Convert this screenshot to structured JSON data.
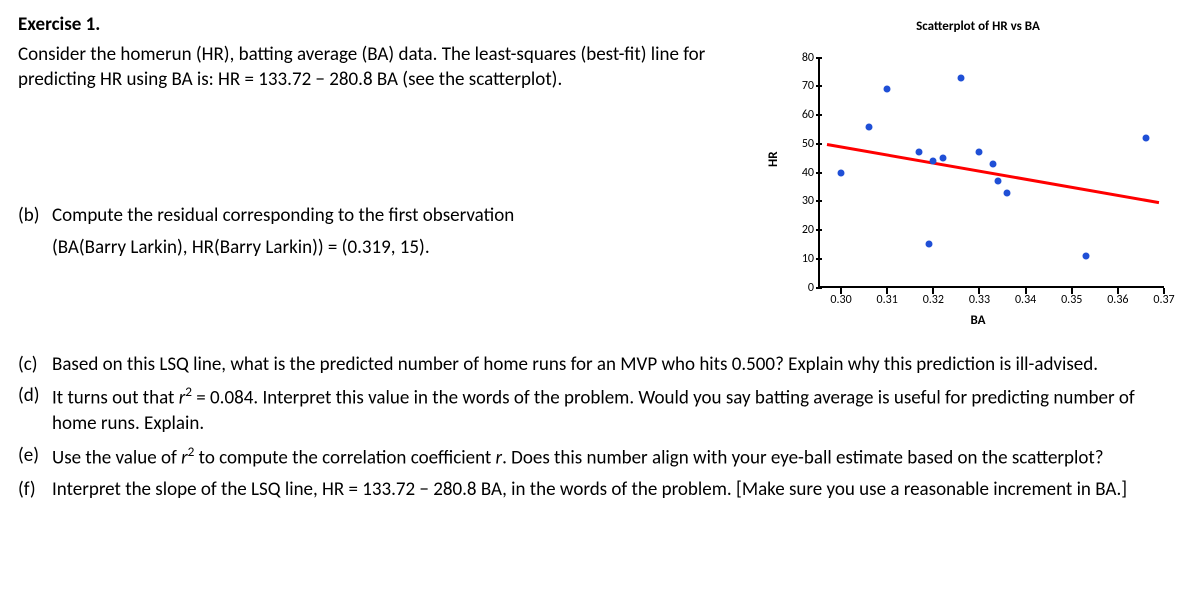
{
  "title": "Exercise 1.",
  "intro_1": "Consider the homerun (HR),  batting average (BA) data.  The least-squares (best-fit) line for predicting HR using BA is:  HR = 133.72  −  280.8 BA  (see the scatterplot).",
  "parts": {
    "b": {
      "label": "(b)",
      "text1": "Compute the residual corresponding to the first observation",
      "text2": "(BA(Barry Larkin),  HR(Barry Larkin)) = (0.319, 15)."
    },
    "c": {
      "label": "(c)",
      "text": "Based on this LSQ line,  what is the predicted number of home runs for an MVP who hits 0.500?   Explain why this prediction is ill-advised."
    },
    "d": {
      "label": "(d)",
      "text": "It turns out that  r²  =  0.084.  Interpret this value in the words of the problem.  Would you say batting average is useful for predicting number of home runs.  Explain."
    },
    "e": {
      "label": "(e)",
      "text": "Use the value of  r²  to compute the correlation coefficient r.   Does this number align with your eye-ball estimate based on the scatterplot?"
    },
    "f": {
      "label": "(f)",
      "text": "Interpret the slope of the LSQ line,  HR = 133.72  −  280.8 BA,  in the words of the problem.  [Make sure you use a reasonable increment in BA.]"
    }
  },
  "chart_data": {
    "type": "scatter",
    "title": "Scatterplot of HR vs BA",
    "xlabel": "BA",
    "ylabel": "HR",
    "xlim": [
      0.295,
      0.37
    ],
    "ylim": [
      0,
      80
    ],
    "x_ticks": [
      0.3,
      0.31,
      0.32,
      0.33,
      0.34,
      0.35,
      0.36,
      0.37
    ],
    "x_tick_labels": [
      "0.30",
      "0.31",
      "0.32",
      "0.33",
      "0.34",
      "0.35",
      "0.36",
      "0.37"
    ],
    "y_ticks": [
      0,
      10,
      20,
      30,
      40,
      50,
      60,
      70,
      80
    ],
    "points": [
      {
        "x": 0.319,
        "y": 15
      },
      {
        "x": 0.3,
        "y": 40
      },
      {
        "x": 0.317,
        "y": 47
      },
      {
        "x": 0.306,
        "y": 56
      },
      {
        "x": 0.31,
        "y": 69
      },
      {
        "x": 0.326,
        "y": 73
      },
      {
        "x": 0.32,
        "y": 44
      },
      {
        "x": 0.322,
        "y": 45
      },
      {
        "x": 0.333,
        "y": 43
      },
      {
        "x": 0.334,
        "y": 37
      },
      {
        "x": 0.336,
        "y": 33
      },
      {
        "x": 0.33,
        "y": 47
      },
      {
        "x": 0.353,
        "y": 11
      },
      {
        "x": 0.366,
        "y": 52
      }
    ],
    "line": {
      "slope": -280.8,
      "intercept": 133.72,
      "x0": 0.297,
      "x1": 0.369
    }
  }
}
